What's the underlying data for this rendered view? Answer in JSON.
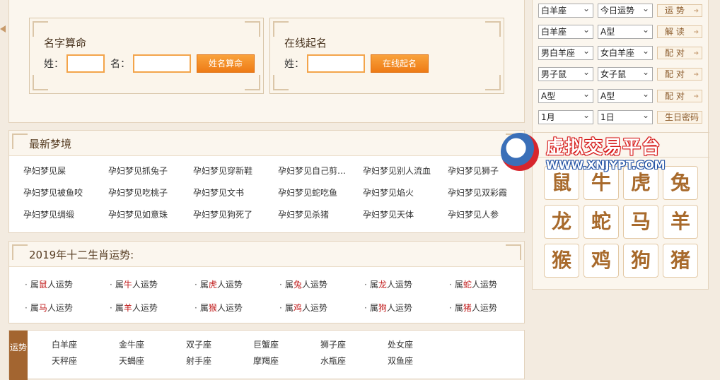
{
  "calc": {
    "name_title": "名字算命",
    "surname_label": "姓：",
    "given_label": "名：",
    "name_button": "姓名算命",
    "online_title": "在线起名",
    "online_surname_label": "姓：",
    "online_button": "在线起名"
  },
  "dreams": {
    "title": "最新梦境",
    "items": [
      "孕妇梦见屎",
      "孕妇梦见抓兔子",
      "孕妇梦见穿新鞋",
      "孕妇梦见自己剪…",
      "孕妇梦见别人流血",
      "孕妇梦见狮子",
      "孕妇梦见被鱼咬",
      "孕妇梦见吃桃子",
      "孕妇梦见文书",
      "孕妇梦见蛇吃鱼",
      "孕妇梦见焰火",
      "孕妇梦见双彩霞",
      "孕妇梦见绸缎",
      "孕妇梦见如意珠",
      "孕妇梦见狗死了",
      "孕妇梦见杀猪",
      "孕妇梦见天体",
      "孕妇梦见人参"
    ]
  },
  "zodiac_fortune": {
    "title": "2019年十二生肖运势:",
    "items": [
      {
        "pre": "属",
        "animal": "鼠",
        "post": "人运势"
      },
      {
        "pre": "属",
        "animal": "牛",
        "post": "人运势"
      },
      {
        "pre": "属",
        "animal": "虎",
        "post": "人运势"
      },
      {
        "pre": "属",
        "animal": "兔",
        "post": "人运势"
      },
      {
        "pre": "属",
        "animal": "龙",
        "post": "人运势"
      },
      {
        "pre": "属",
        "animal": "蛇",
        "post": "人运势"
      },
      {
        "pre": "属",
        "animal": "马",
        "post": "人运势"
      },
      {
        "pre": "属",
        "animal": "羊",
        "post": "人运势"
      },
      {
        "pre": "属",
        "animal": "猴",
        "post": "人运势"
      },
      {
        "pre": "属",
        "animal": "鸡",
        "post": "人运势"
      },
      {
        "pre": "属",
        "animal": "狗",
        "post": "人运势"
      },
      {
        "pre": "属",
        "animal": "猪",
        "post": "人运势"
      }
    ]
  },
  "horoscope": {
    "tag": "运势",
    "signs": [
      "白羊座",
      "金牛座",
      "双子座",
      "巨蟹座",
      "狮子座",
      "处女座",
      "天秤座",
      "天蝎座",
      "射手座",
      "摩羯座",
      "水瓶座",
      "双鱼座"
    ]
  },
  "tools": {
    "rows": [
      {
        "sel1": "白羊座",
        "sel2": "今日运势",
        "button": "运 势"
      },
      {
        "sel1": "白羊座",
        "sel2": "A型",
        "button": "解 读"
      },
      {
        "sel1": "男白羊座",
        "sel2": "女白羊座",
        "button": "配 对"
      },
      {
        "sel1": "男子鼠",
        "sel2": "女子鼠",
        "button": "配 对"
      },
      {
        "sel1": "A型",
        "sel2": "A型",
        "button": "配 对"
      },
      {
        "sel1": "1月",
        "sel2": "1日",
        "button": "生日密码"
      }
    ],
    "zodiac_animals": [
      "鼠",
      "牛",
      "虎",
      "兔",
      "龙",
      "蛇",
      "马",
      "羊",
      "猴",
      "鸡",
      "狗",
      "猪"
    ]
  },
  "watermark": {
    "line1": "虚拟交易平台",
    "line2": "WWW.XNJYPT.COM"
  },
  "colors": {
    "accent_orange": "#f08a24",
    "zodiac_red": "#c01a1a",
    "brown": "#a36530"
  }
}
